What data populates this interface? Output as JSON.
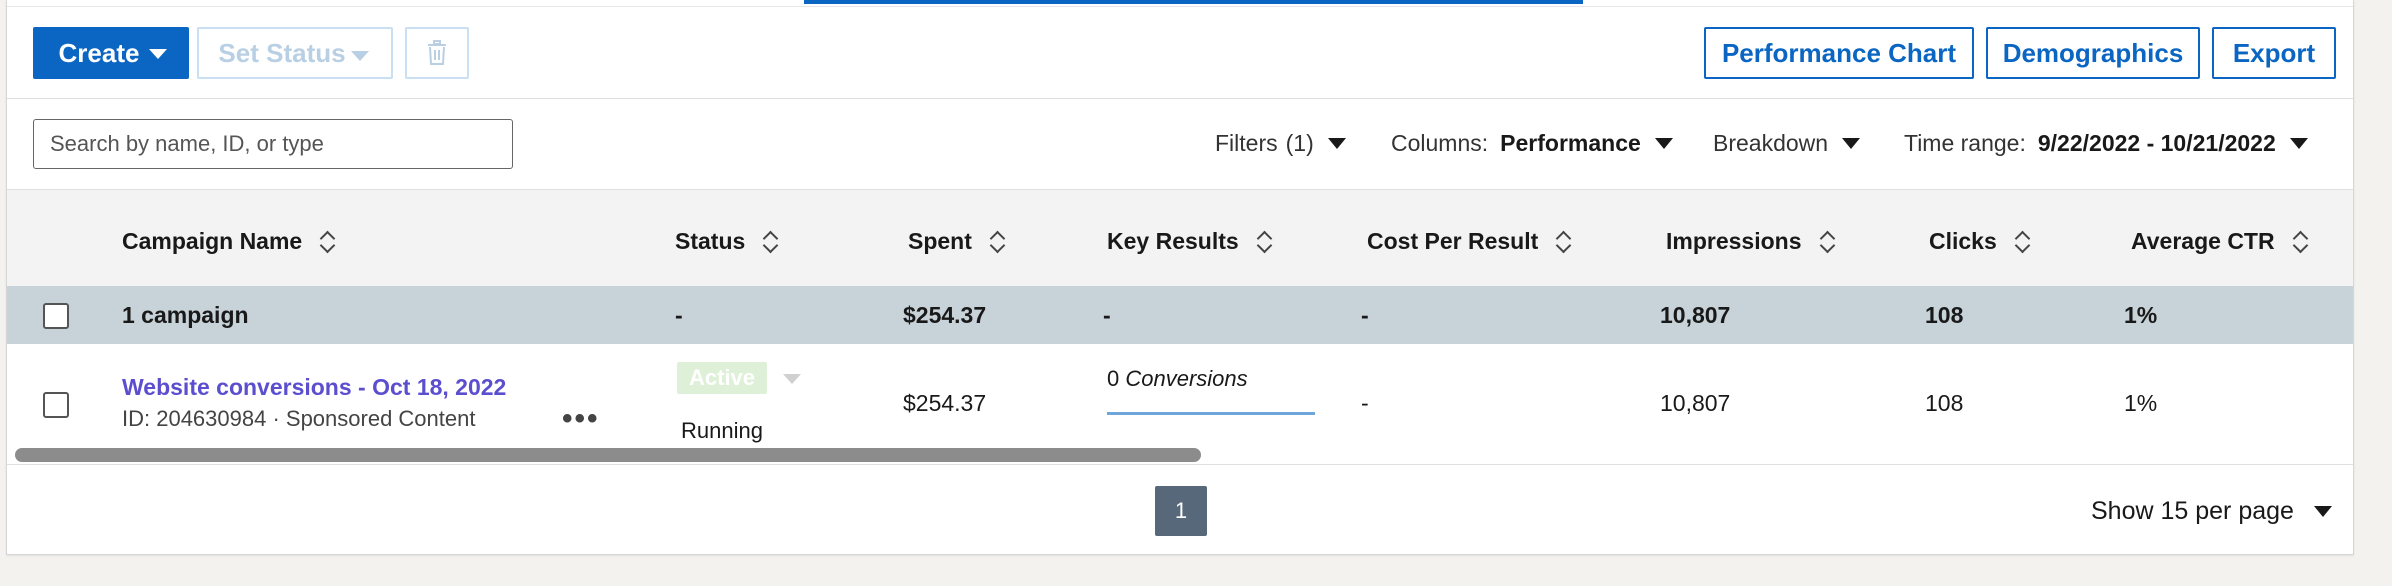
{
  "toolbar": {
    "create_label": "Create",
    "set_status_label": "Set Status",
    "performance_chart_label": "Performance Chart",
    "demographics_label": "Demographics",
    "export_label": "Export"
  },
  "filters": {
    "search_placeholder": "Search by name, ID, or type",
    "filters_label": "Filters",
    "filters_count": "(1)",
    "columns_label": "Columns:",
    "columns_value": "Performance",
    "breakdown_label": "Breakdown",
    "time_range_label": "Time range:",
    "time_range_value": "9/22/2022 - 10/21/2022"
  },
  "table": {
    "headers": [
      "Campaign Name",
      "Status",
      "Spent",
      "Key Results",
      "Cost Per Result",
      "Impressions",
      "Clicks",
      "Average CTR"
    ],
    "summary": {
      "name": "1 campaign",
      "status": "-",
      "spent": "$254.37",
      "key_results": "-",
      "cost_per_result": "-",
      "impressions": "10,807",
      "clicks": "108",
      "ctr": "1%"
    },
    "rows": [
      {
        "name": "Website conversions - Oct 18, 2022",
        "sub": "ID: 204630984 · Sponsored Content",
        "more": "•••",
        "status_badge": "Active",
        "status_text": "Running",
        "spent": "$254.37",
        "key_results_count": "0",
        "key_results_unit": "Conversions",
        "cost_per_result": "-",
        "impressions": "10,807",
        "clicks": "108",
        "ctr": "1%"
      }
    ]
  },
  "pagination": {
    "current_page": "1",
    "per_page_label": "Show 15 per page"
  },
  "icons": {
    "trash": "trash-icon",
    "caret": "caret-down-icon",
    "sort": "sort-icon"
  },
  "colors": {
    "accent": "#0a66c2",
    "link": "#5b4ecf",
    "summary_bg": "#c7d2d9",
    "page_active": "#56687a"
  }
}
